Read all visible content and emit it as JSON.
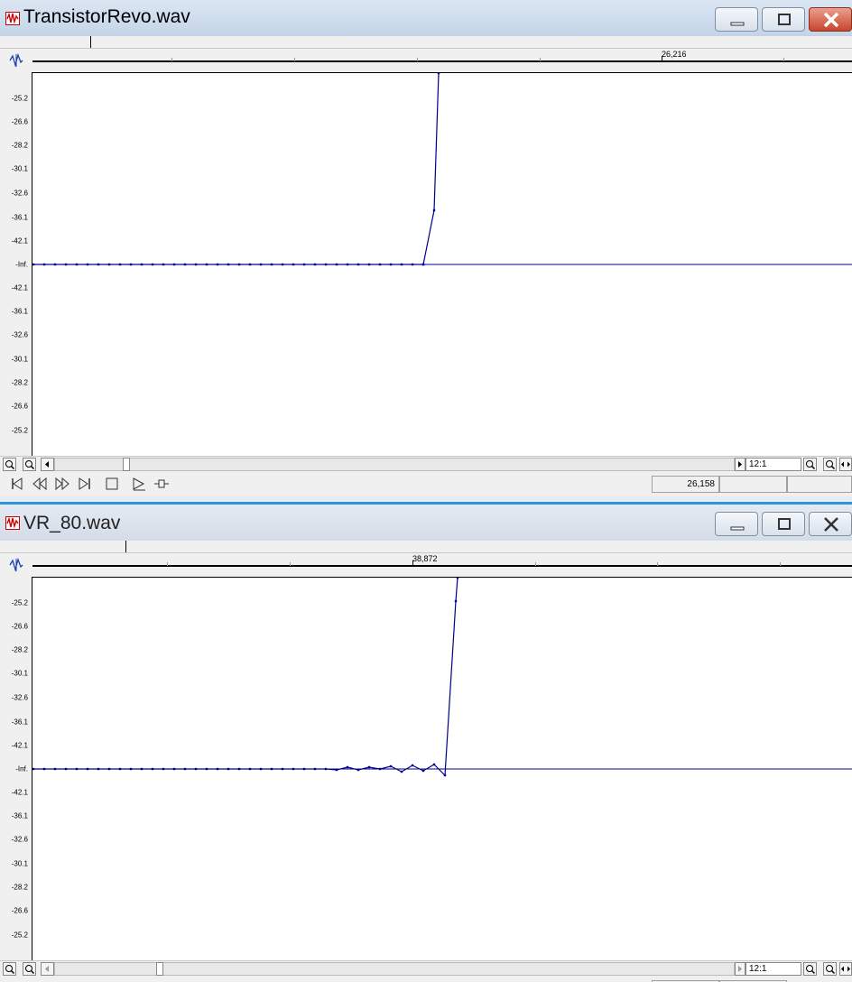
{
  "windows": [
    {
      "title": "TransistorRevo.wav",
      "time_marker": "26,216",
      "amplitude_labels": [
        "-25.2",
        "-26.6",
        "-28.2",
        "-30.1",
        "-32.6",
        "-36.1",
        "-42.1",
        "-Inf.",
        "-42.1",
        "-36.1",
        "-32.6",
        "-30.1",
        "-28.2",
        "-26.6",
        "-25.2"
      ],
      "zoom": "12:1",
      "position_value": "26,158"
    },
    {
      "title": "VR_80.wav",
      "time_marker": "38,872",
      "amplitude_labels": [
        "-25.2",
        "-26.6",
        "-28.2",
        "-30.1",
        "-32.6",
        "-36.1",
        "-42.1",
        "-Inf.",
        "-42.1",
        "-36.1",
        "-32.6",
        "-30.1",
        "-28.2",
        "-26.6",
        "-25.2"
      ],
      "zoom": "12:1"
    }
  ],
  "icons": {
    "app": "waveform-app-icon",
    "minimize": "minimize-icon",
    "maximize": "maximize-icon",
    "close": "close-icon",
    "zoom_in": "zoom-in-icon",
    "zoom_out": "zoom-out-icon",
    "scroll_left": "scroll-left-arrow-icon",
    "scroll_right": "scroll-right-arrow-icon",
    "go_start": "go-to-start-icon",
    "rewind": "rewind-icon",
    "fast_forward": "fast-forward-icon",
    "go_end": "go-to-end-icon",
    "stop": "stop-icon",
    "play": "play-icon",
    "loop": "loop-icon"
  },
  "colors": {
    "waveform": "#00008b",
    "close_button": "#c8452f",
    "window_border_active": "#2c95d6"
  }
}
